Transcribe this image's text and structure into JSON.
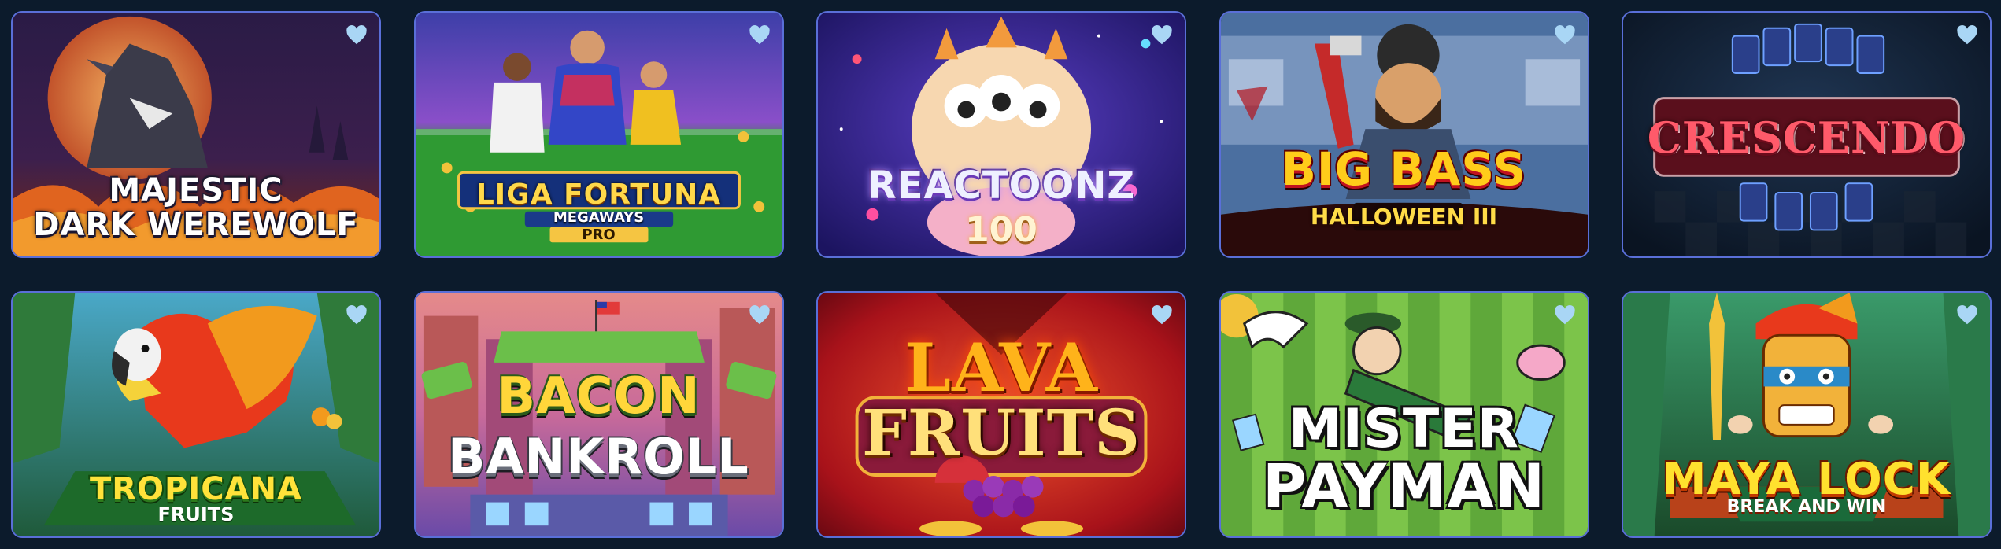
{
  "colors": {
    "page_background": "#0c1b2c",
    "card_border": "#5a6fd8",
    "favorite_heart": "#a9d6f5"
  },
  "games": [
    {
      "title_lines": [
        "MAJESTIC",
        "DARK WEREWOLF"
      ],
      "theme": "werewolf-moon-purple",
      "favorite_icon": "heart-icon"
    },
    {
      "title_lines": [
        "LIGA FORTUNA"
      ],
      "badge_top": "MEGAWAYS",
      "badge_bottom": "PRO",
      "theme": "football-stadium",
      "favorite_icon": "heart-icon"
    },
    {
      "title_lines": [
        "REACTOONZ"
      ],
      "subtitle": "100",
      "theme": "space-monster",
      "favorite_icon": "heart-icon"
    },
    {
      "title_lines": [
        "BIG BASS"
      ],
      "subtitle": "HALLOWEEN III",
      "theme": "halloween-fisherman",
      "favorite_icon": "heart-icon"
    },
    {
      "title_lines": [
        "CRESCENDO"
      ],
      "theme": "cards-checkerboard",
      "favorite_icon": "heart-icon"
    },
    {
      "title_lines": [
        "TROPICANA"
      ],
      "subtitle": "FRUITS",
      "theme": "jungle-parrot",
      "favorite_icon": "heart-icon"
    },
    {
      "title_lines": [
        "BACON",
        "BANKROLL"
      ],
      "theme": "city-money",
      "favorite_icon": "heart-icon"
    },
    {
      "title_lines": [
        "LAVA",
        "FRUITS"
      ],
      "theme": "lava-fruits",
      "favorite_icon": "heart-icon"
    },
    {
      "title_lines": [
        "MISTER",
        "PAYMAN"
      ],
      "theme": "green-cartoon",
      "favorite_icon": "heart-icon"
    },
    {
      "title_lines": [
        "MAYA LOCK"
      ],
      "subtitle": "BREAK AND WIN",
      "theme": "jungle-mask",
      "favorite_icon": "heart-icon"
    }
  ]
}
